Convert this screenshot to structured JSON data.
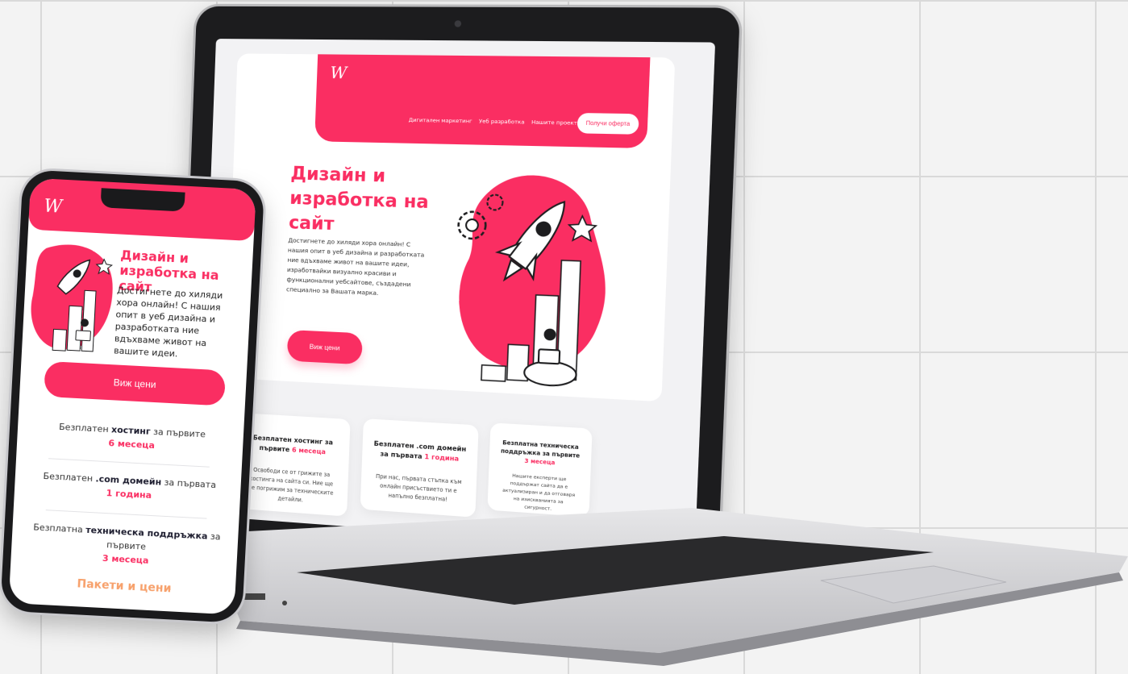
{
  "brand": {
    "logo": "W",
    "accent": "#fa2e62",
    "secondary": "#f7a16c"
  },
  "desktop": {
    "nav": [
      "Дигитален маркетинг",
      "Уеб разработка",
      "Нашите проекти"
    ],
    "quote_button": "Получи оферта",
    "hero_title": "Дизайн и изработка на сайт",
    "hero_text": "Достигнете до хиляди хора онлайн! С нашия опит в уеб дизайна и разработката ние вдъхваме живот на вашите идеи, изработвайки визуално красиви и функционални уебсайтове, създадени специално за Вашата марка.",
    "hero_button": "Виж цени",
    "features": [
      {
        "title_a": "Безплатен хостинг за първите ",
        "title_hl": "6 месеца",
        "text": "Освободи се от грижите за хостинга на сайта си. Ние ще се погрижим за техническите детайли."
      },
      {
        "title_a": "Безплатен .com домейн за първата ",
        "title_hl": "1 година",
        "text": "При нас, първата стъпка към онлайн присъствието ти е напълно безплатна!"
      },
      {
        "title_a": "Безплатна техническа поддръжка за първите ",
        "title_hl": "3 месеца",
        "text": "Нашите експерти ще поддържат сайта да е актуализиран и да отговаря на изискванията за сигурност."
      }
    ]
  },
  "mobile": {
    "hero_title": "Дизайн и изработка на сайт",
    "hero_text": "Достигнете до хиляди хора онлайн! С нашия опит в уеб дизайна и разработката ние вдъхваме живот на вашите идеи.",
    "button": "Виж цени",
    "items": [
      {
        "pre": "Безплатен ",
        "bold": "хостинг",
        "mid": " за първите ",
        "hl": "6 месеца"
      },
      {
        "pre": "Безплатен ",
        "bold": ".com домейн",
        "mid": " за първата ",
        "hl": "1 година"
      },
      {
        "pre": "Безплатна ",
        "bold": "техническа поддръжка",
        "mid": " за първите ",
        "hl": "3 месеца"
      }
    ],
    "packages": "Пакети и цени"
  }
}
